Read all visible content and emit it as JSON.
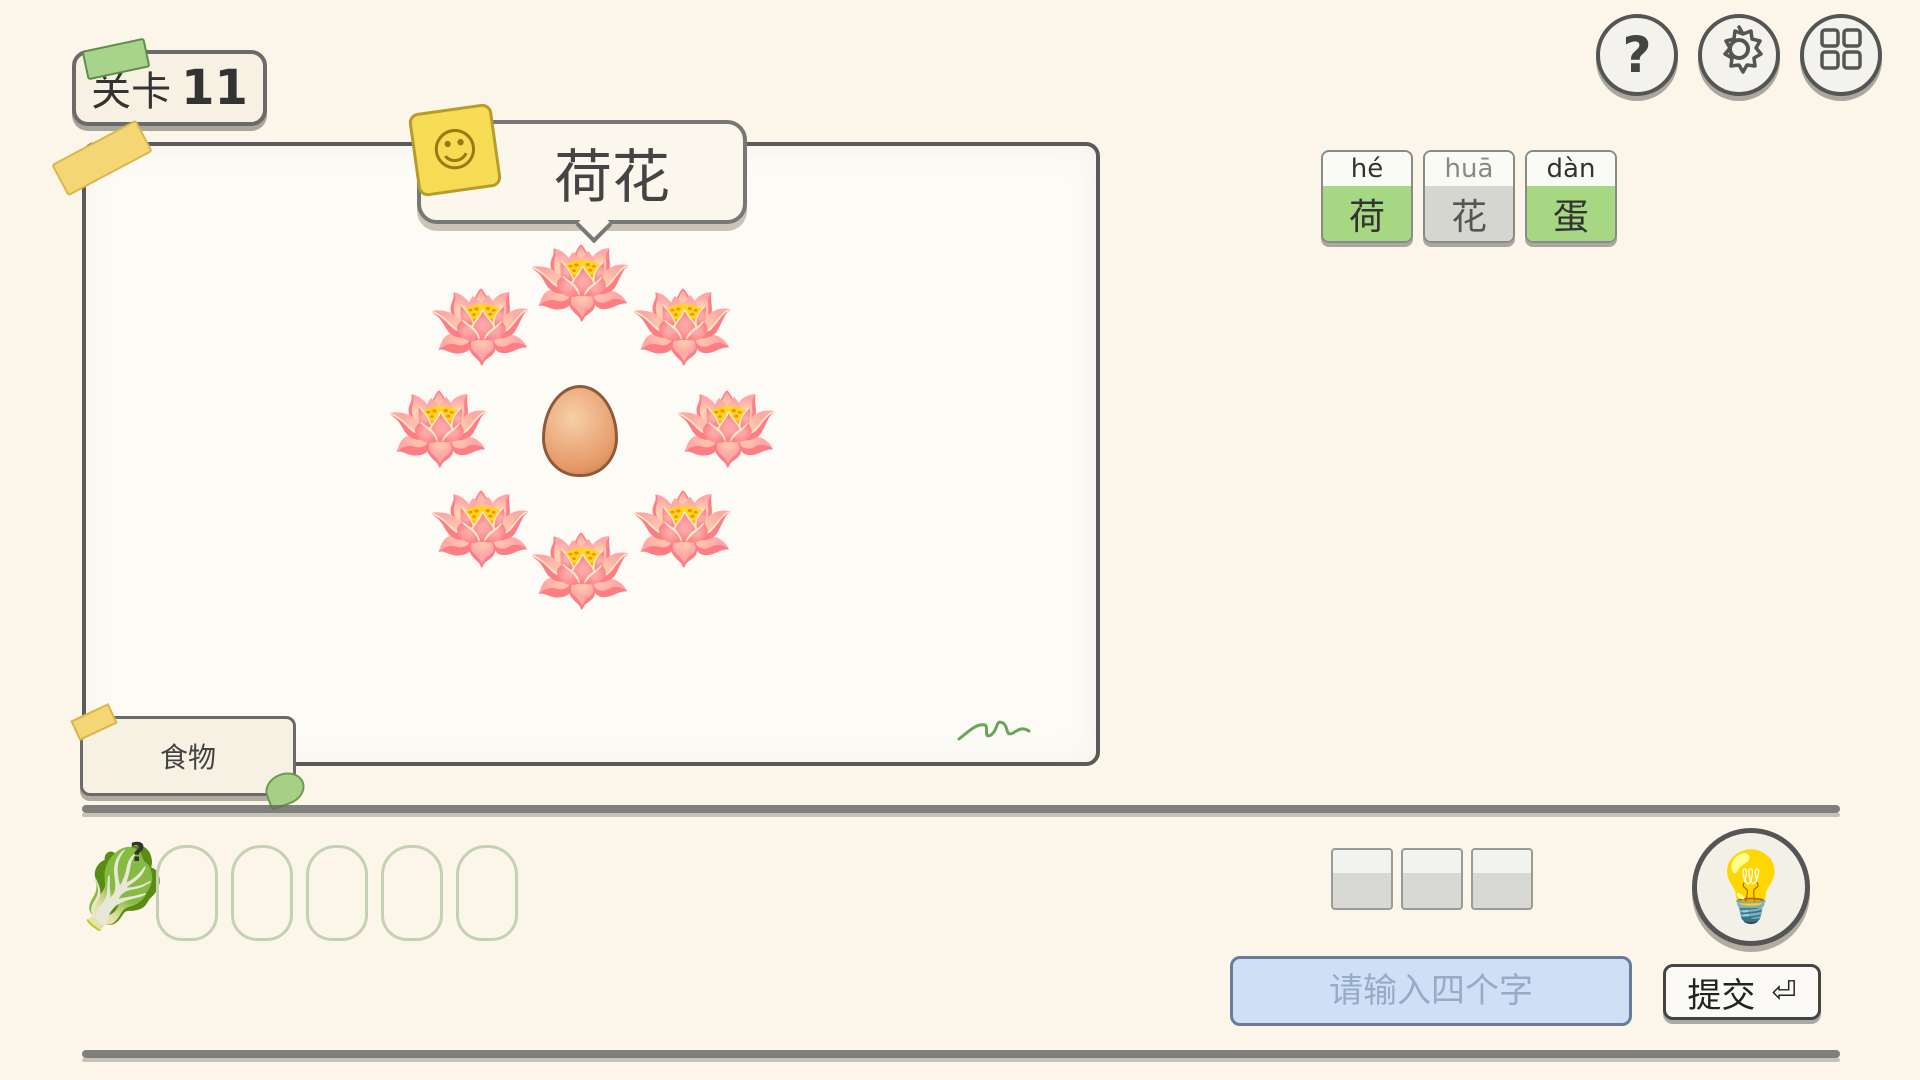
{
  "level": {
    "prefix": "关卡",
    "number": "11"
  },
  "top_buttons": [
    {
      "name": "help",
      "icon": "question-icon",
      "glyph": "?"
    },
    {
      "name": "settings",
      "icon": "gear-icon",
      "glyph": "⚙"
    },
    {
      "name": "menu",
      "icon": "grid-icon",
      "glyph": "▦"
    }
  ],
  "puzzle": {
    "revealed_answer": "荷花",
    "category": "食物",
    "icons": {
      "flower": "lotus-icon",
      "center": "egg-icon"
    }
  },
  "pinyin_tiles": [
    {
      "pinyin": "hé",
      "hanzi": "荷",
      "state": "correct",
      "color": "#a6d884"
    },
    {
      "pinyin": "huā",
      "hanzi": "花",
      "state": "absent",
      "color": "#d6d6d0"
    },
    {
      "pinyin": "dàn",
      "hanzi": "蛋",
      "state": "correct",
      "color": "#a6d884"
    }
  ],
  "bottom": {
    "hint_slot_count": 5,
    "answer_box_count": 3,
    "input_placeholder": "请输入四个字",
    "submit_label": "提交",
    "enter_glyph": "⏎"
  }
}
